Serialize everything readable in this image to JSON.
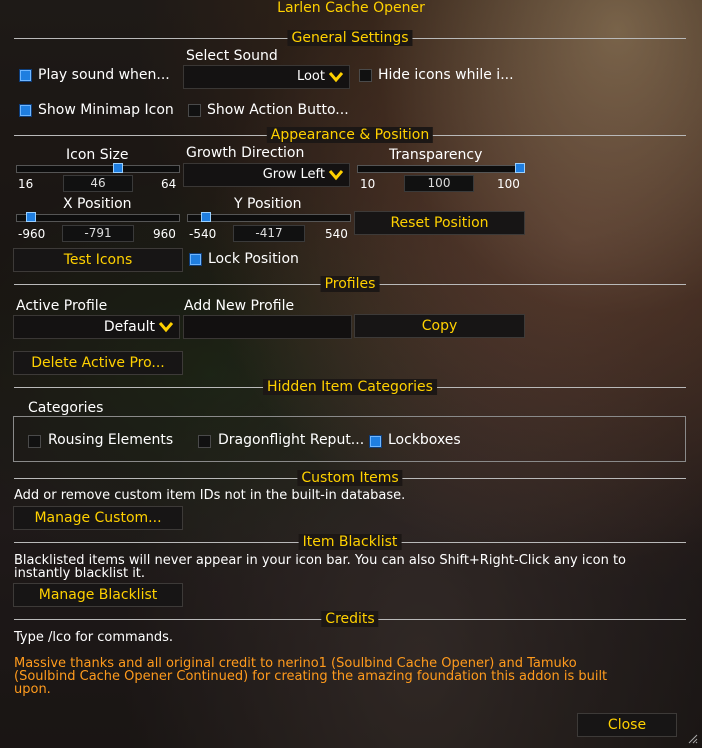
{
  "window": {
    "title": "Larlen Cache Opener"
  },
  "colors": {
    "gold": "#ffd100",
    "orange": "#ff9b1d",
    "check_blue": "#1f7ee0"
  },
  "general": {
    "header": "General Settings",
    "select_sound_label": "Select Sound",
    "sound_value": "Loot",
    "play_sound": {
      "label": "Play sound when...",
      "checked": true
    },
    "hide_icons": {
      "label": "Hide icons while i...",
      "checked": false
    },
    "show_minimap": {
      "label": "Show Minimap Icon",
      "checked": true
    },
    "show_action": {
      "label": "Show Action Butto...",
      "checked": false
    }
  },
  "appearance": {
    "header": "Appearance & Position",
    "icon_size": {
      "label": "Icon Size",
      "min": "16",
      "value": "46",
      "max": "64",
      "fraction": 0.625
    },
    "growth": {
      "label": "Growth Direction",
      "value": "Grow Left"
    },
    "transparency": {
      "label": "Transparency",
      "min": "10",
      "value": "100",
      "max": "100",
      "fraction": 1.0
    },
    "x_pos": {
      "label": "X Position",
      "min": "-960",
      "value": "-791",
      "max": "960",
      "fraction": 0.088
    },
    "y_pos": {
      "label": "Y Position",
      "min": "-540",
      "value": "-417",
      "max": "540",
      "fraction": 0.114
    },
    "reset_label": "Reset Position",
    "test_label": "Test Icons",
    "lock": {
      "label": "Lock Position",
      "checked": true
    }
  },
  "profiles": {
    "header": "Profiles",
    "active_label": "Active Profile",
    "active_value": "Default",
    "add_label": "Add New Profile",
    "add_value": "",
    "copy_label": "Copy",
    "delete_label": "Delete Active Pro..."
  },
  "hidden": {
    "header": "Hidden Item Categories",
    "categories_label": "Categories",
    "items": [
      {
        "label": "Rousing Elements",
        "checked": false
      },
      {
        "label": "Dragonflight Reput...",
        "checked": false
      },
      {
        "label": "Lockboxes",
        "checked": true
      }
    ]
  },
  "custom": {
    "header": "Custom Items",
    "desc": "Add or remove custom item IDs not in the built-in database.",
    "button": "Manage Custom..."
  },
  "blacklist": {
    "header": "Item Blacklist",
    "desc_line1": "Blacklisted items will never appear in your icon bar. You can also Shift+Right-Click any icon to",
    "desc_line2": "instantly blacklist it.",
    "button": "Manage Blacklist"
  },
  "credits": {
    "header": "Credits",
    "cmd": "Type /lco for commands.",
    "thanks_line1": "Massive thanks and all original credit to nerino1 (Soulbind Cache Opener) and Tamuko",
    "thanks_line2": "(Soulbind Cache Opener Continued) for creating the amazing foundation this addon is built",
    "thanks_line3": "upon."
  },
  "footer": {
    "close_label": "Close"
  }
}
